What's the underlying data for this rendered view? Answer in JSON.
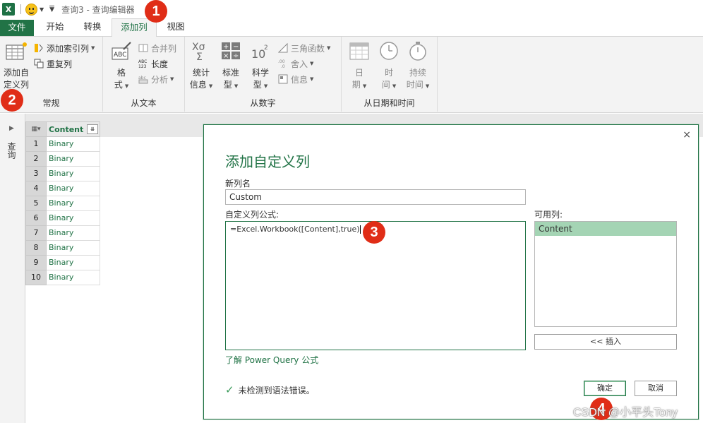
{
  "titlebar": {
    "app_icon": "X",
    "window_title": "查询3 - 查询编辑器"
  },
  "badges": {
    "b1": "1",
    "b2": "2",
    "b3": "3",
    "b4": "4"
  },
  "tabs": {
    "file": "文件",
    "home": "开始",
    "transform": "转换",
    "add_column": "添加列",
    "view": "视图"
  },
  "ribbon": {
    "general": {
      "custom_column_1": "添加自",
      "custom_column_2": "定义列",
      "index_column": "添加索引列",
      "duplicate_column": "重复列",
      "label": "常规"
    },
    "from_text": {
      "format_1": "格",
      "format_2": "式",
      "merge_columns": "合并列",
      "length": "长度",
      "parse": "分析",
      "label": "从文本"
    },
    "from_number": {
      "statistics_1": "统计",
      "statistics_2": "信息",
      "standard_1": "标准",
      "standard_2": "型",
      "scientific_1": "科学",
      "scientific_2": "型",
      "trigonometry": "三角函数",
      "rounding": "舍入",
      "information": "信息",
      "label": "从数字"
    },
    "from_datetime": {
      "date_1": "日",
      "date_2": "期",
      "time_1": "时",
      "time_2": "间",
      "duration_1": "持续",
      "duration_2": "时间",
      "label": "从日期和时间"
    }
  },
  "leftpane": {
    "label": "查询"
  },
  "grid": {
    "column_header": "Content",
    "rows": [
      "Binary",
      "Binary",
      "Binary",
      "Binary",
      "Binary",
      "Binary",
      "Binary",
      "Binary",
      "Binary",
      "Binary"
    ],
    "row_numbers": [
      "1",
      "2",
      "3",
      "4",
      "5",
      "6",
      "7",
      "8",
      "9",
      "10"
    ]
  },
  "dialog": {
    "title": "添加自定义列",
    "new_column_label": "新列名",
    "new_column_value": "Custom",
    "formula_label": "自定义列公式:",
    "formula_value": "=Excel.Workbook([Content],true)",
    "available_label": "可用列:",
    "available_columns": [
      "Content"
    ],
    "insert_button": "<< 插入",
    "learn_link": "了解 Power Query 公式",
    "status_text": "未检测到语法错误。",
    "ok_button": "确定",
    "cancel_button": "取消",
    "close_glyph": "×"
  },
  "watermark": "CSDN @小平头Tony",
  "colors": {
    "accent": "#217346",
    "badge": "#e02d17",
    "selected_item": "#a4d4b4"
  }
}
